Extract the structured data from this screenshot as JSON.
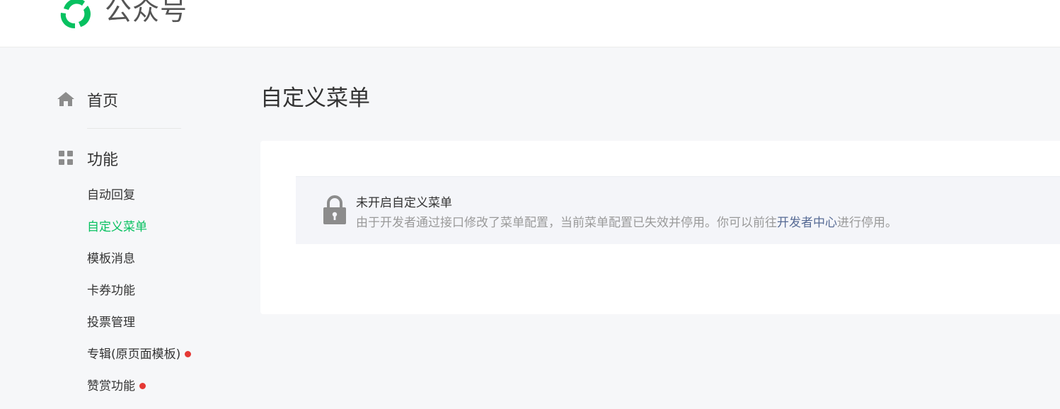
{
  "brand": {
    "name": "公众号",
    "icon": "wechat-mp-logo-icon",
    "color": "#07c160"
  },
  "sidebar": {
    "home": {
      "label": "首页",
      "icon": "home-icon"
    },
    "functions": {
      "label": "功能",
      "icon": "grid-icon"
    },
    "items": [
      {
        "label": "自动回复",
        "active": false,
        "badge": false
      },
      {
        "label": "自定义菜单",
        "active": true,
        "badge": false
      },
      {
        "label": "模板消息",
        "active": false,
        "badge": false
      },
      {
        "label": "卡券功能",
        "active": false,
        "badge": false
      },
      {
        "label": "投票管理",
        "active": false,
        "badge": false
      },
      {
        "label": "专辑(原页面模板)",
        "active": false,
        "badge": true
      },
      {
        "label": "赞赏功能",
        "active": false,
        "badge": true
      }
    ]
  },
  "main": {
    "title": "自定义菜单",
    "notice": {
      "icon": "lock-icon",
      "title": "未开启自定义菜单",
      "desc_before": "由于开发者通过接口修改了菜单配置，当前菜单配置已失效并停用。你可以前往",
      "link": "开发者中心",
      "desc_after": "进行停用。"
    }
  },
  "colors": {
    "accent": "#07c160",
    "link": "#576b95",
    "badge": "#e53935"
  }
}
